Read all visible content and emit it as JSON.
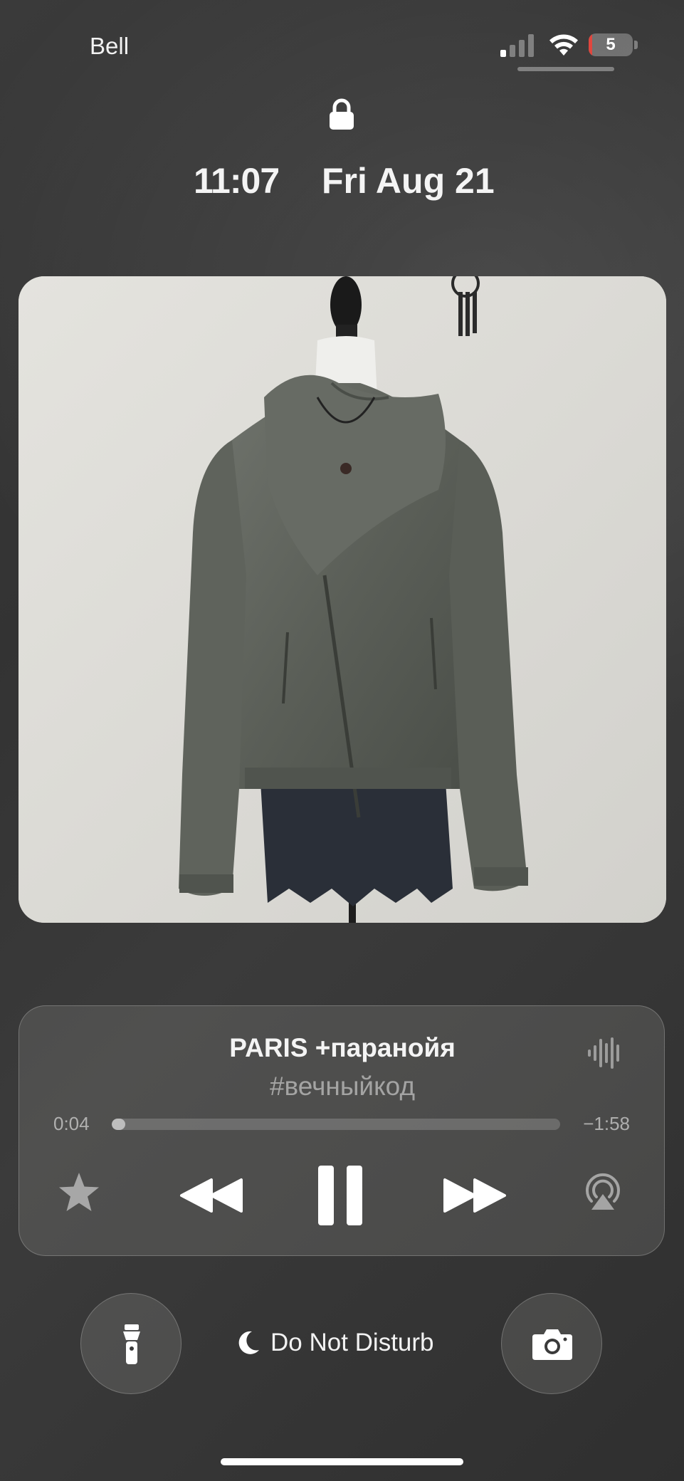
{
  "status_bar": {
    "carrier": "Bell",
    "battery_level": "5",
    "battery_fraction": 0.05,
    "signal_bars_active": 1,
    "signal_bars_total": 4,
    "battery_color": "#e0463e"
  },
  "lock_screen": {
    "time": "11:07",
    "date": "Fri Aug 21",
    "lock_icon": "lock-icon"
  },
  "now_playing": {
    "artwork": "album-artwork",
    "title": "PARIS +паранойя",
    "artist": "#вечныйкод",
    "elapsed": "0:04",
    "remaining": "−1:58",
    "progress_fraction": 0.03,
    "controls": {
      "favorite_icon": "star-icon",
      "previous_icon": "rewind-icon",
      "play_pause_icon": "pause-icon",
      "next_icon": "fast-forward-icon",
      "output_icon": "airplay-icon",
      "audio_indicator_icon": "waveform-icon"
    }
  },
  "quick_actions": {
    "left_icon": "flashlight-icon",
    "focus_icon": "moon-icon",
    "focus_label": "Do Not Disturb",
    "right_icon": "camera-icon"
  }
}
